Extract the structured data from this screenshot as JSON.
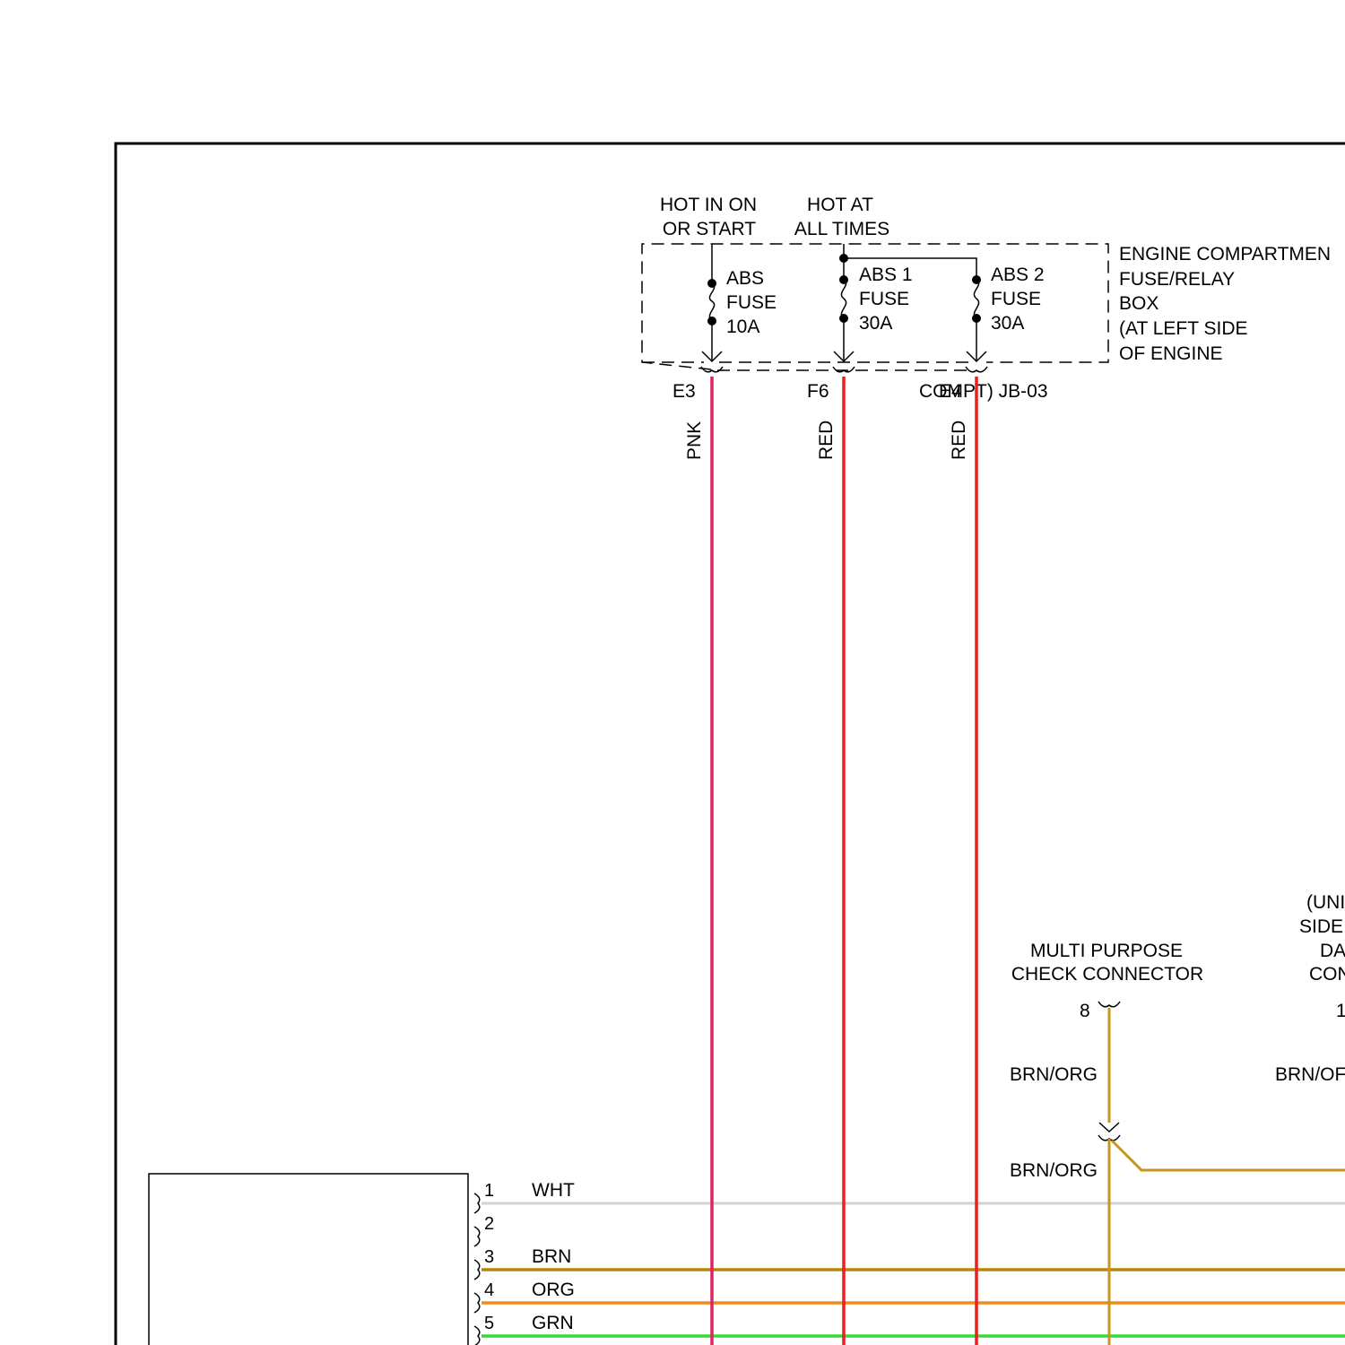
{
  "power_sources": {
    "hot_in_on": [
      "HOT IN ON",
      "OR START"
    ],
    "hot_at_all_times": [
      "HOT AT",
      "ALL TIMES"
    ]
  },
  "fuse_box": {
    "label": [
      "ENGINE COMPARTMEN",
      "FUSE/RELAY",
      "BOX",
      "(AT LEFT SIDE",
      "OF ENGINE"
    ],
    "connector_label": "COMPT) JB-03",
    "fuses": [
      {
        "name": "ABS",
        "type": "FUSE",
        "rating": "10A",
        "pin": "E3",
        "wire": "PNK"
      },
      {
        "name": "ABS 1",
        "type": "FUSE",
        "rating": "30A",
        "pin": "F6",
        "wire": "RED"
      },
      {
        "name": "ABS 2",
        "type": "FUSE",
        "rating": "30A",
        "pin": "E4",
        "wire": "RED"
      }
    ]
  },
  "check_connector": {
    "label": [
      "MULTI PURPOSE",
      "CHECK CONNECTOR"
    ],
    "pin": "8",
    "wire_upper": "BRN/ORG",
    "wire_lower": "BRN/ORG"
  },
  "data_connector": {
    "label": [
      "(UNI",
      "SIDE",
      "DA",
      "CON"
    ],
    "pin": "1",
    "wire": "BRN/OF"
  },
  "module_pins": [
    {
      "pin": "1",
      "wire": "WHT"
    },
    {
      "pin": "2",
      "wire": ""
    },
    {
      "pin": "3",
      "wire": "BRN"
    },
    {
      "pin": "4",
      "wire": "ORG"
    },
    {
      "pin": "5",
      "wire": "GRN"
    }
  ],
  "colors": {
    "pnk": "#e0245e",
    "red": "#e82020",
    "wht": "#d2d2d2",
    "brn": "#b8860b",
    "brn_org": "#c8961e",
    "org": "#f08a1c",
    "grn": "#33dd33"
  }
}
